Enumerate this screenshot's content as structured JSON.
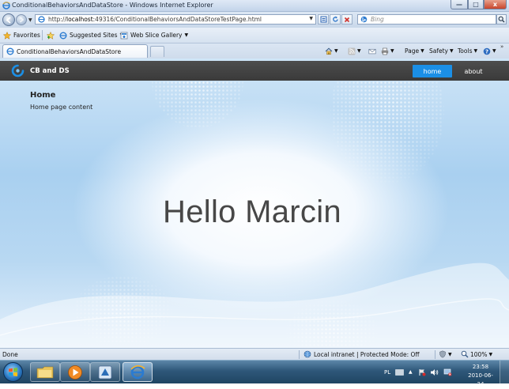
{
  "window": {
    "title": "ConditionalBehaviorsAndDataStore - Windows Internet Explorer",
    "min_glyph": "—",
    "max_glyph": "□",
    "close_glyph": "x"
  },
  "address_bar": {
    "url_prefix": "http://",
    "url_host": "localhost",
    "url_path": ":49316/ConditionalBehaviorsAndDataStoreTestPage.html",
    "search_placeholder": "Bing"
  },
  "favorites_bar": {
    "favorites_label": "Favorites",
    "suggested_sites_label": "Suggested Sites",
    "web_slice_gallery_label": "Web Slice Gallery"
  },
  "tabs": [
    {
      "label": "ConditionalBehaviorsAndDataStore"
    }
  ],
  "command_bar": {
    "page_label": "Page",
    "safety_label": "Safety",
    "tools_label": "Tools",
    "overflow_glyph": "»"
  },
  "page": {
    "brand": "CB and DS",
    "nav": [
      {
        "label": "home",
        "active": true
      },
      {
        "label": "about",
        "active": false
      }
    ],
    "title": "Home",
    "subtitle": "Home page content",
    "hero_text": "Hello Marcin",
    "accent_color": "#1b8fe6",
    "header_color": "#404040"
  },
  "status_bar": {
    "status_text": "Done",
    "zone_text": "Local intranet | Protected Mode: Off",
    "zoom": "100%"
  },
  "taskbar": {
    "language": "PL",
    "time": "23:58",
    "date": "2010-06-24",
    "apps": [
      {
        "name": "windows-explorer"
      },
      {
        "name": "media-player"
      },
      {
        "name": "expression-blend"
      },
      {
        "name": "internet-explorer",
        "active": true
      }
    ]
  }
}
